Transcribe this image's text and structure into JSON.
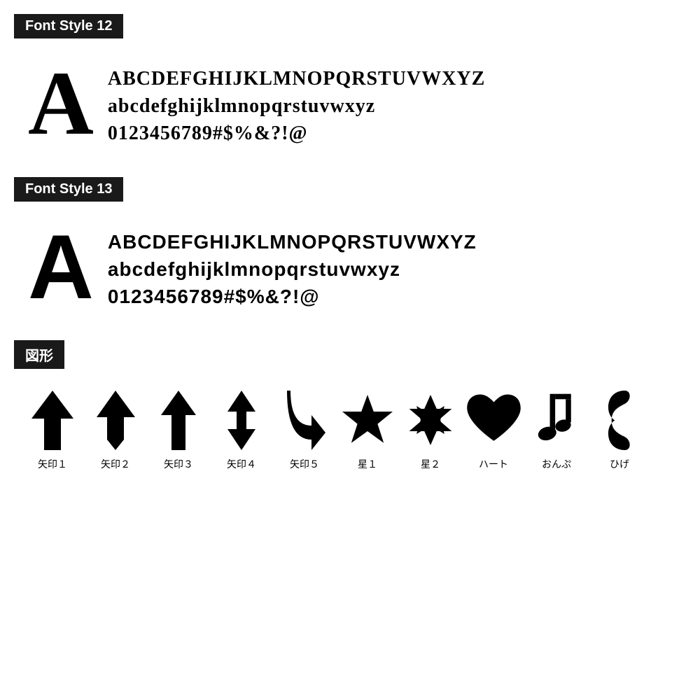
{
  "sections": [
    {
      "id": "font-style-12",
      "label": "Font Style 12",
      "bigLetter": "A",
      "lines": [
        "ABCDEFGHIJKLMNOPQRSTUVWXYZ",
        "abcdefghijklmnopqrstuvwxyz",
        "0123456789#$%&?!@"
      ],
      "fontClass": "style12"
    },
    {
      "id": "font-style-13",
      "label": "Font Style 13",
      "bigLetter": "A",
      "lines": [
        "ABCDEFGHIJKLMNOPQRSTUVWXYZ",
        "abcdefghijklmnopqrstuvwxyz",
        "0123456789#$%&?!@"
      ],
      "fontClass": "style13"
    }
  ],
  "shapesSection": {
    "label": "図形",
    "shapes": [
      {
        "id": "yajirushi1",
        "label": "矢印１"
      },
      {
        "id": "yajirushi2",
        "label": "矢印２"
      },
      {
        "id": "yajirushi3",
        "label": "矢印３"
      },
      {
        "id": "yajirushi4",
        "label": "矢印４"
      },
      {
        "id": "yajirushi5",
        "label": "矢印５"
      },
      {
        "id": "hoshi1",
        "label": "星１"
      },
      {
        "id": "hoshi2",
        "label": "星２"
      },
      {
        "id": "heart",
        "label": "ハート"
      },
      {
        "id": "onpu",
        "label": "おんぷ"
      },
      {
        "id": "hige",
        "label": "ひげ"
      }
    ]
  }
}
